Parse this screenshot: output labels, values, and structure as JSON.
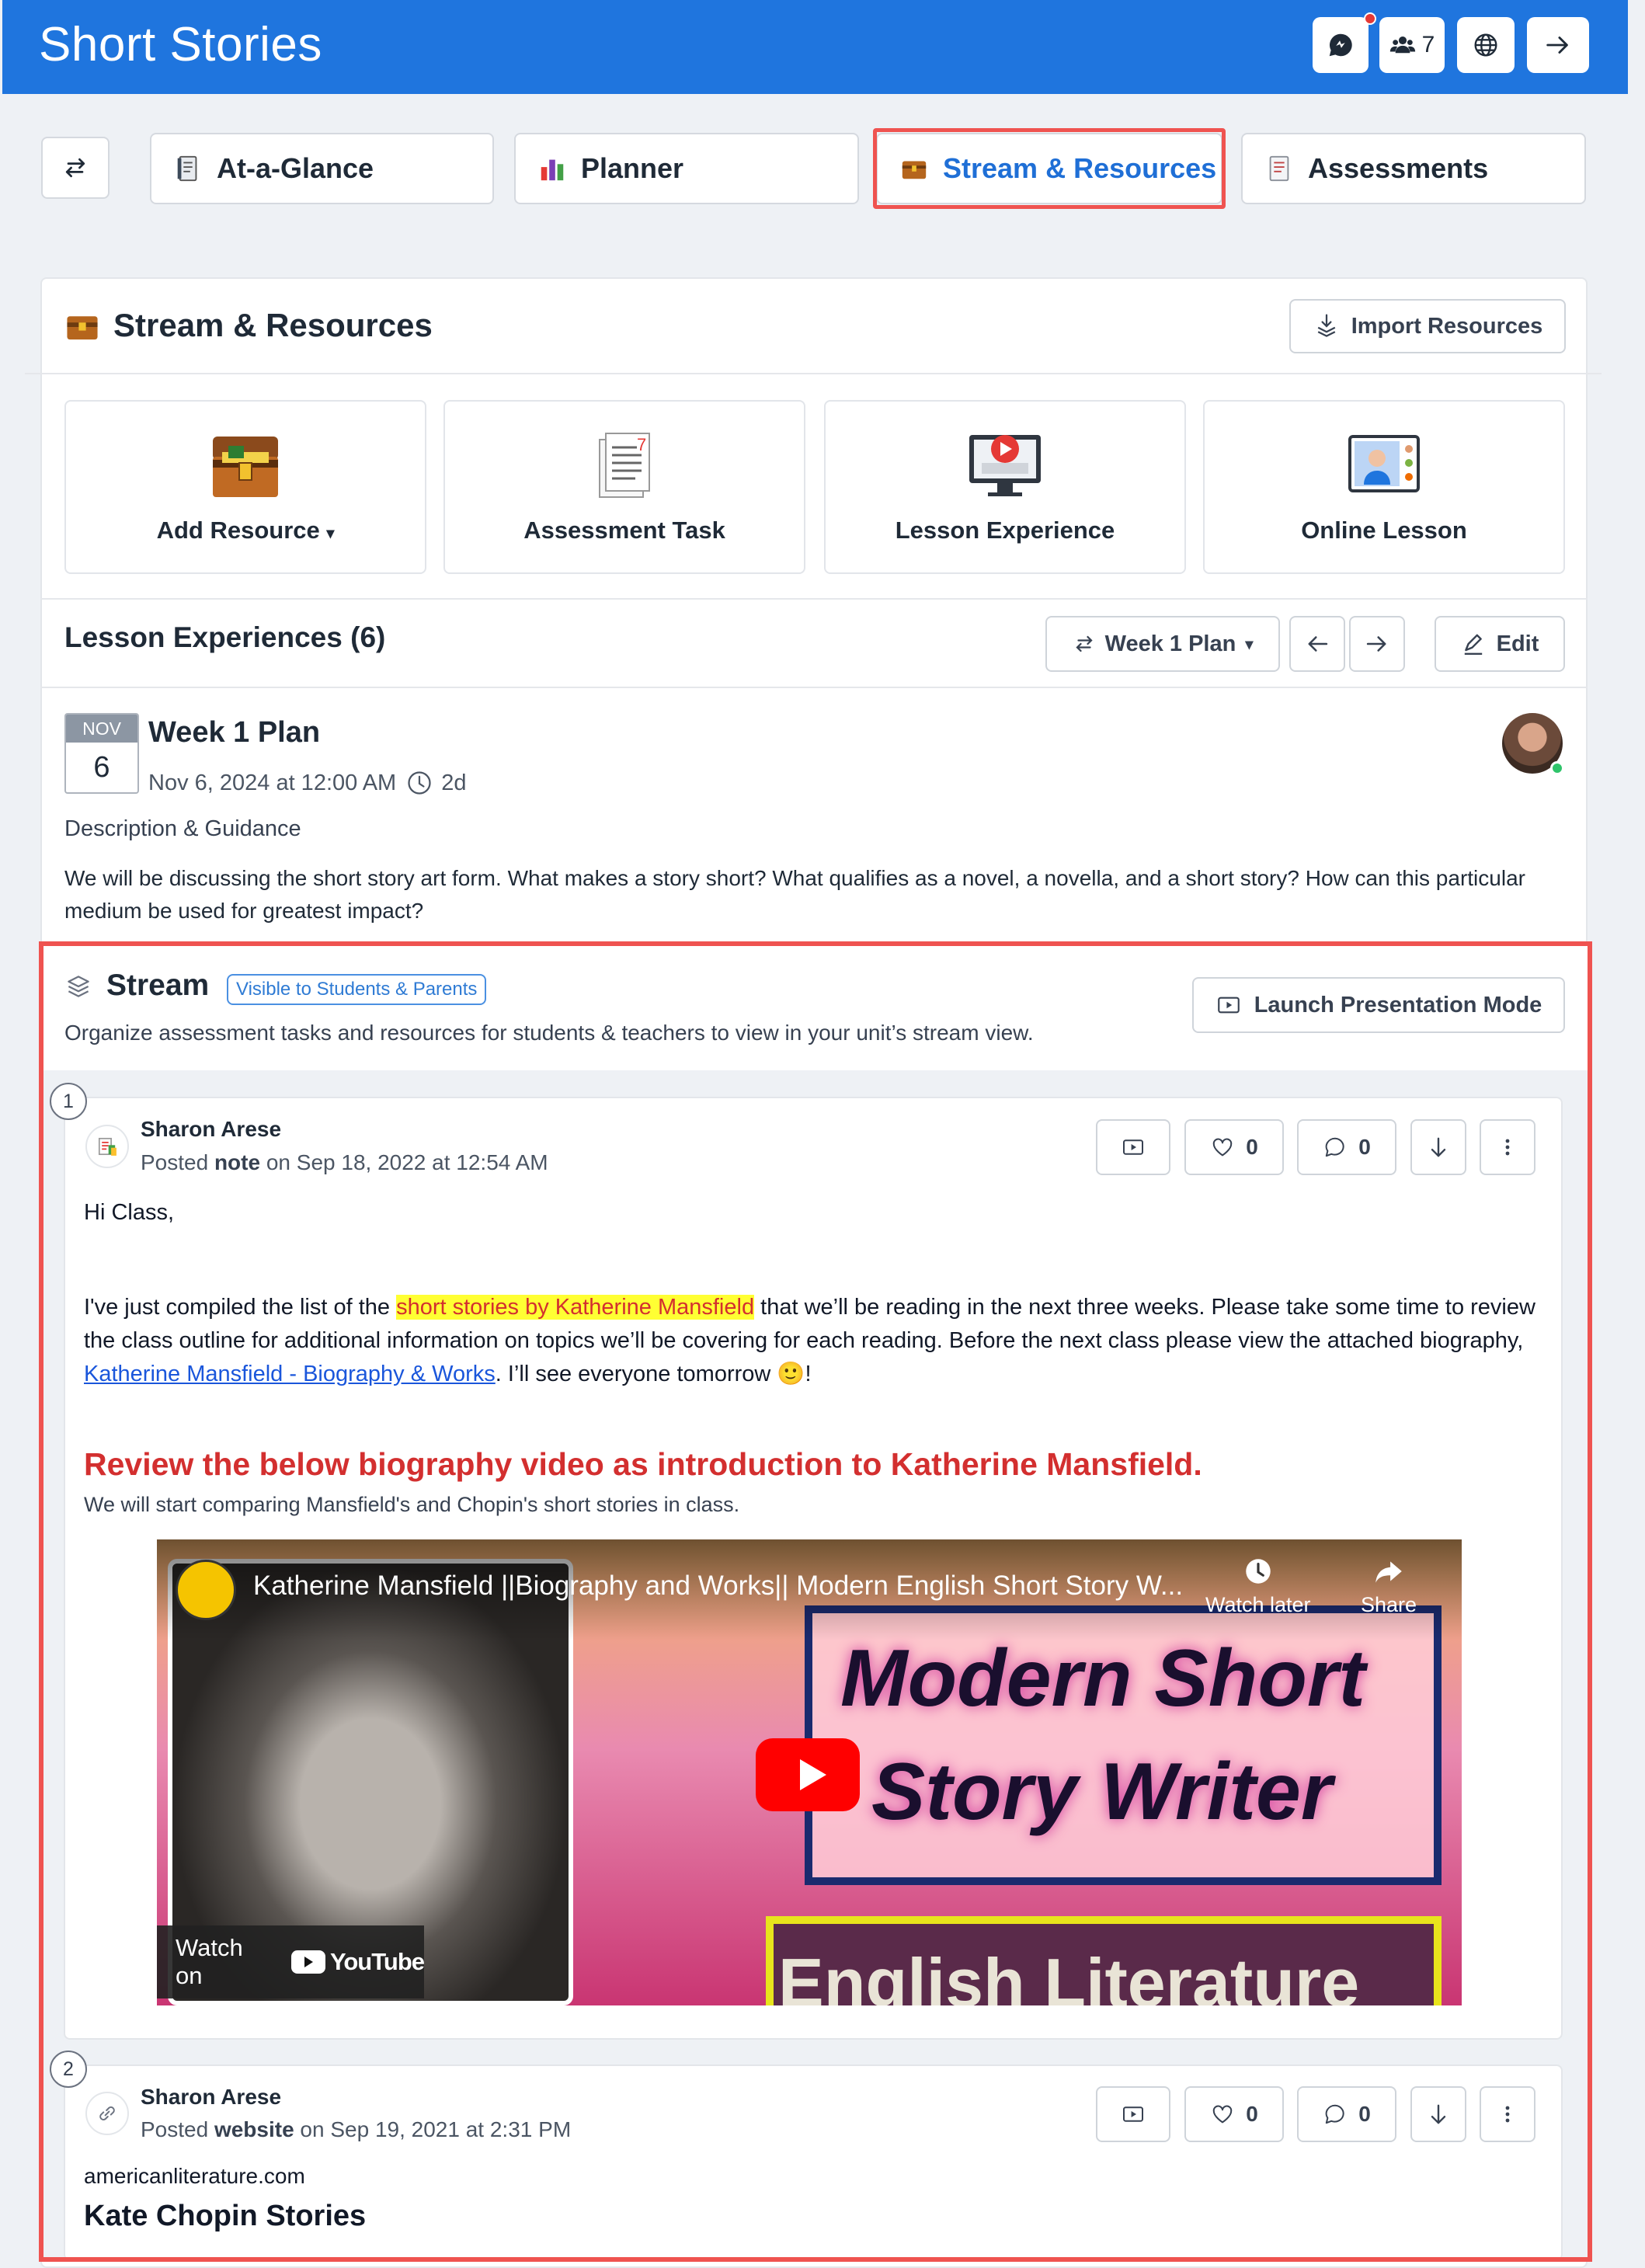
{
  "header": {
    "title": "Short Stories",
    "members_count": "7"
  },
  "tabs": [
    {
      "label": "At-a-Glance"
    },
    {
      "label": "Planner"
    },
    {
      "label": "Stream & Resources"
    },
    {
      "label": "Assessments"
    }
  ],
  "section": {
    "title": "Stream & Resources",
    "import_label": "Import Resources"
  },
  "tiles": [
    {
      "label": "Add Resource"
    },
    {
      "label": "Assessment Task"
    },
    {
      "label": "Lesson Experience"
    },
    {
      "label": "Online Lesson"
    }
  ],
  "lessons": {
    "title": "Lesson Experiences (6)",
    "plan_select": "Week 1 Plan",
    "edit_label": "Edit"
  },
  "plan": {
    "month": "NOV",
    "day": "6",
    "title": "Week 1 Plan",
    "date": "Nov 6, 2024 at 12:00 AM",
    "duration": "2d",
    "desc_heading": "Description & Guidance",
    "description": "We will be discussing the short story art form. What makes a story short? What qualifies as a novel, a novella, and a short story? How can this particular medium be used for greatest impact?"
  },
  "stream": {
    "title": "Stream",
    "badge": "Visible to Students & Parents",
    "subtitle": "Organize assessment tasks and resources for students & teachers to view in your unit’s stream view.",
    "launch_label": "Launch Presentation Mode"
  },
  "posts": [
    {
      "number": "1",
      "author": "Sharon Arese",
      "meta_prefix": "Posted ",
      "type": "note",
      "meta_suffix": " on Sep 18, 2022 at 12:54 AM",
      "likes": "0",
      "comments": "0",
      "greeting": "Hi Class,",
      "para_part1": "I've just compiled the list of the ",
      "highlight": "short stories by Katherine Mansfield",
      "para_part2": " that we’ll be reading in the next three weeks. Please take some time to review the class outline for additional information on topics we’ll be covering for each reading. Before the next class please view the attached biography, ",
      "link_text": "Katherine Mansfield - Biography & Works",
      "para_part3": ". I’ll see everyone tomorrow 🙂!",
      "heading": "Review the below biography video as introduction to Katherine Mansfield.",
      "subheading": "We will start comparing Mansfield's and Chopin's short stories in class.",
      "video": {
        "title": "Katherine Mansfield ||Biography and Works|| Modern English Short Story W...",
        "watch_later": "Watch later",
        "share": "Share",
        "text_line1": "Modern Short",
        "text_line2": "Story Writer",
        "text_line3": "English Literature",
        "watch_on": "Watch on",
        "youtube": "YouTube"
      }
    },
    {
      "number": "2",
      "author": "Sharon Arese",
      "meta_prefix": "Posted ",
      "type": "website",
      "meta_suffix": " on Sep 19, 2021 at 2:31 PM",
      "likes": "0",
      "comments": "0",
      "site": "americanliterature.com",
      "site_title": "Kate Chopin Stories"
    }
  ],
  "colors": {
    "header_blue": "#1f75de",
    "highlight_outline": "#ef5350",
    "heading_red": "#d32f2f"
  }
}
